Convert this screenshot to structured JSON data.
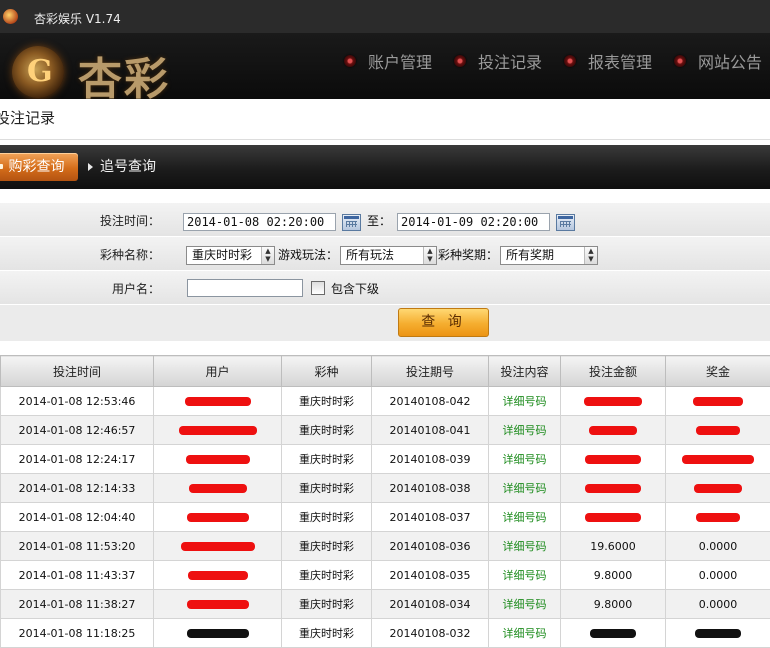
{
  "window": {
    "title": "杏彩娱乐 V1.74"
  },
  "header": {
    "logo_text": "杏彩",
    "nav": [
      "账户管理",
      "投注记录",
      "报表管理",
      "网站公告"
    ]
  },
  "page": {
    "title": "投注记录"
  },
  "tabs": {
    "active": "购彩查询",
    "other": "追号查询"
  },
  "filters": {
    "bet_time_label": "投注时间：",
    "start": "2014-01-08 02:20:00",
    "to_label": "至：",
    "end": "2014-01-09 02:20:00",
    "lottery_label": "彩种名称：",
    "lottery_value": "重庆时时彩",
    "play_label": "游戏玩法：",
    "play_value": "所有玩法",
    "issue_label": "彩种奖期：",
    "issue_value": "所有奖期",
    "username_label": "用户名：",
    "username_value": "",
    "include_sub_label": "包含下级",
    "include_sub_checked": false,
    "query_button": "查 询"
  },
  "table": {
    "headers": [
      "投注时间",
      "用户",
      "彩种",
      "投注期号",
      "投注内容",
      "投注金额",
      "奖金"
    ],
    "rows": [
      {
        "time": "2014-01-08 12:53:46",
        "user": "",
        "lottery": "重庆时时彩",
        "issue": "20140108-042",
        "content": "详细号码",
        "amount": "",
        "prize": ""
      },
      {
        "time": "2014-01-08 12:46:57",
        "user": "",
        "lottery": "重庆时时彩",
        "issue": "20140108-041",
        "content": "详细号码",
        "amount": "",
        "prize": ""
      },
      {
        "time": "2014-01-08 12:24:17",
        "user": "",
        "lottery": "重庆时时彩",
        "issue": "20140108-039",
        "content": "详细号码",
        "amount": "",
        "prize": ""
      },
      {
        "time": "2014-01-08 12:14:33",
        "user": "",
        "lottery": "重庆时时彩",
        "issue": "20140108-038",
        "content": "详细号码",
        "amount": "",
        "prize": ""
      },
      {
        "time": "2014-01-08 12:04:40",
        "user": "",
        "lottery": "重庆时时彩",
        "issue": "20140108-037",
        "content": "详细号码",
        "amount": "",
        "prize": ""
      },
      {
        "time": "2014-01-08 11:53:20",
        "user": "",
        "lottery": "重庆时时彩",
        "issue": "20140108-036",
        "content": "详细号码",
        "amount": "19.6000",
        "prize": "0.0000"
      },
      {
        "time": "2014-01-08 11:43:37",
        "user": "",
        "lottery": "重庆时时彩",
        "issue": "20140108-035",
        "content": "详细号码",
        "amount": "9.8000",
        "prize": "0.0000"
      },
      {
        "time": "2014-01-08 11:38:27",
        "user": "",
        "lottery": "重庆时时彩",
        "issue": "20140108-034",
        "content": "详细号码",
        "amount": "9.8000",
        "prize": "0.0000"
      },
      {
        "time": "2014-01-08 11:18:25",
        "user": "",
        "lottery": "重庆时时彩",
        "issue": "20140108-032",
        "content": "详细号码",
        "amount": "",
        "prize": ""
      }
    ]
  },
  "colors": {
    "accent": "#f5ad2f",
    "tab_active": "#d46d1a",
    "detail_link": "#1a8a1a",
    "redaction_red": "#ee1010",
    "redaction_black": "#111111"
  }
}
